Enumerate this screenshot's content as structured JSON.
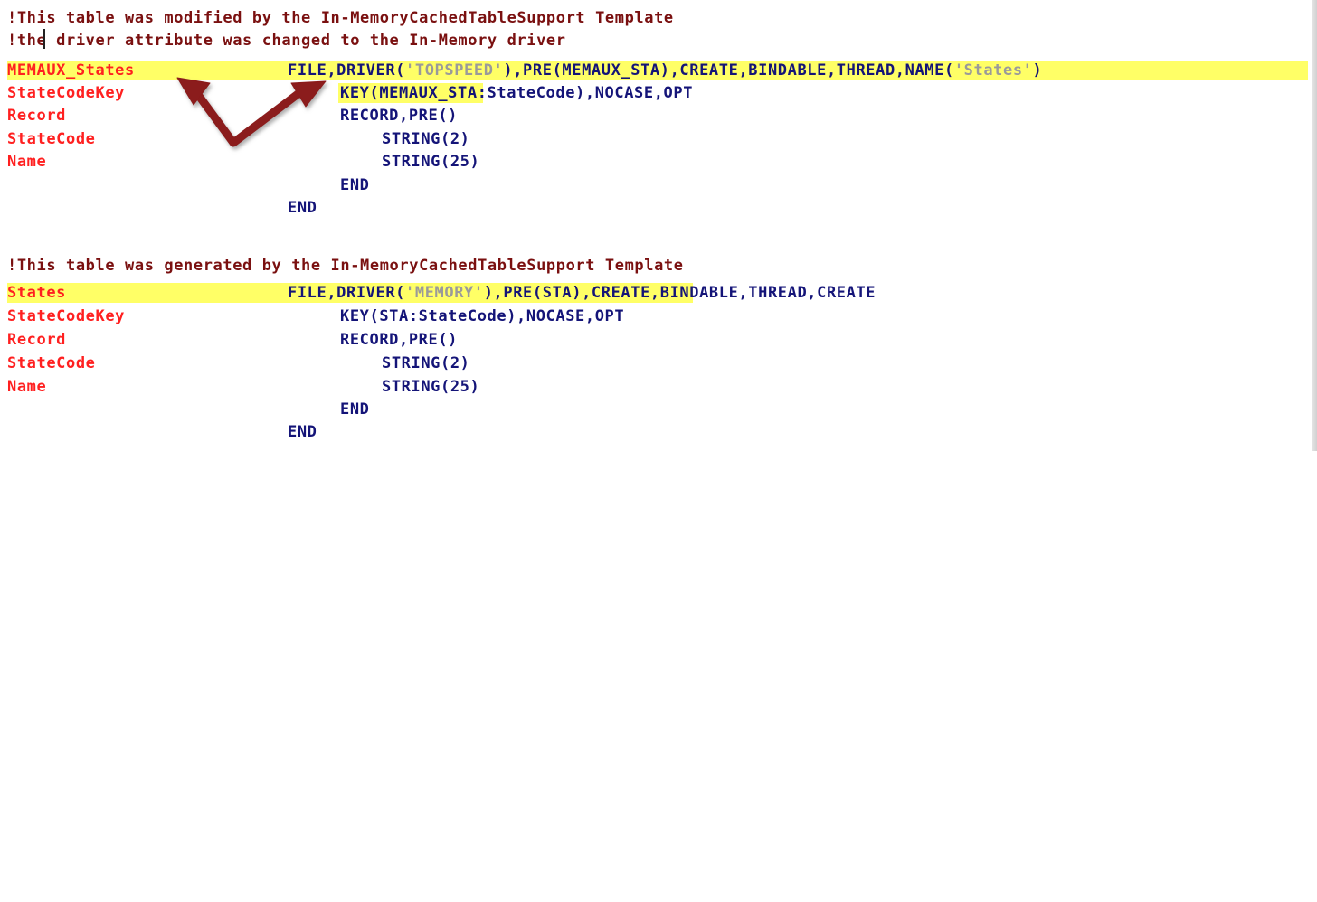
{
  "block1": {
    "comment1": "!This table was modified by the In-MemoryCachedTableSupport Template",
    "comment2": "!the driver attribute was changed to the In-Memory driver",
    "file_label": "MEMAUX_States",
    "file_code_a": "FILE,DRIVER(",
    "file_str": "'TOPSPEED'",
    "file_code_b": "),PRE(MEMAUX_STA)",
    "file_code_c": ",CREATE,BINDABLE,THREAD,NAME(",
    "file_str2": "'States'",
    "file_code_d": ")",
    "key_label": "StateCodeKey",
    "key_code": "KEY(MEMAUX_STA:StateCode),NOCASE,OPT",
    "record_label": "Record",
    "record_code": "RECORD,PRE()",
    "statecode_label": "StateCode",
    "statecode_code": "STRING(2)",
    "name_label": "Name",
    "name_code": "STRING(25)",
    "end_inner": "END",
    "end_outer": "END"
  },
  "block2": {
    "comment": "!This table was generated by the In-MemoryCachedTableSupport Template",
    "file_label": "States",
    "file_code_a": "FILE,DRIVER(",
    "file_str": "'MEMORY'",
    "file_code_b": "),PRE(STA)",
    "file_code_c": ",CREATE,BINDABLE,THREAD,CREATE",
    "key_label": "StateCodeKey",
    "key_code": "KEY(STA:StateCode),NOCASE,OPT",
    "record_label": "Record",
    "record_code": "RECORD,PRE()",
    "statecode_label": "StateCode",
    "statecode_code": "STRING(2)",
    "name_label": "Name",
    "name_code": "STRING(25)",
    "end_inner": "END",
    "end_outer": "END"
  },
  "colors": {
    "comment": "#7a1010",
    "label": "#ff2020",
    "keyword": "#141478",
    "string": "#9a9a9a",
    "highlight": "#ffff66",
    "arrow": "#8b1a1a"
  },
  "annotation": {
    "icon": "double-arrow-annotation-icon"
  }
}
